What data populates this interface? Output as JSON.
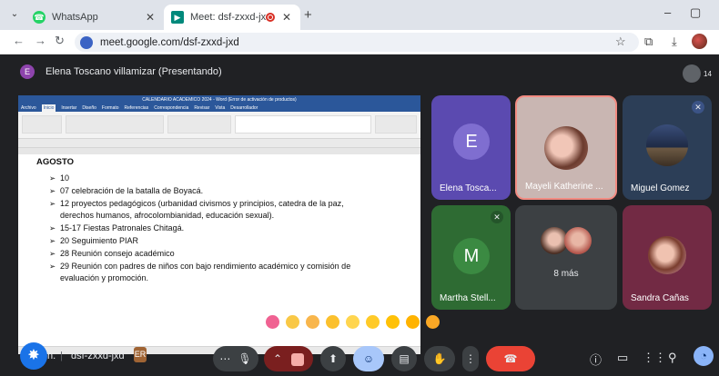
{
  "browser": {
    "tabs": [
      {
        "title": "WhatsApp",
        "icon": "whatsapp-icon"
      },
      {
        "title": "Meet: dsf-zxxd-jxd",
        "icon": "meet-icon",
        "recording": true
      }
    ],
    "url": "meet.google.com/dsf-zxxd-jxd"
  },
  "meet": {
    "presenter_initial": "E",
    "presenter_text": "Elena Toscano villamizar (Presentando)",
    "participant_count": "14",
    "meeting_code": "dsf-zxxd-jxd",
    "host_initial_partial": "n.",
    "code_chip_letter": "ER"
  },
  "document": {
    "window_title": "CALENDARIO ACADEMICO 2024 - Word (Error de activación de productos)",
    "ribbon_tabs": [
      "Archivo",
      "Inicio",
      "Insertar",
      "Diseño",
      "Formato",
      "Referencias",
      "Correspondencia",
      "Revisar",
      "Vista",
      "Desarrollador"
    ],
    "heading": "AGOSTO",
    "items": [
      "10",
      "07 celebración de la batalla de Boyacá.",
      "12 proyectos pedagógicos (urbanidad civismos y principios, catedra de la paz,",
      "derechos humanos, afrocolombianidad, educación sexual).",
      "15-17 Fiestas Patronales Chitagá.",
      "20 Seguimiento PIAR",
      "28 Reunión consejo académico",
      "29 Reunión con padres de niños con bajo rendimiento académico y comisión de",
      "evaluación y promoción."
    ]
  },
  "tiles": [
    {
      "name": "Elena Tosca...",
      "initial": "E",
      "color": "#5b4ab0"
    },
    {
      "name": "Mayeli Katherine ...",
      "color": "#c9b6b2"
    },
    {
      "name": "Miguel Gomez",
      "color": "#2c3e57"
    },
    {
      "name": "Martha Stell...",
      "initial": "M",
      "color": "#2e6b33"
    },
    {
      "name": "8 más",
      "color": "#3c4043"
    },
    {
      "name": "Sandra Cañas",
      "color": "#722a44"
    }
  ],
  "reactions": [
    "sparkling-heart",
    "thumbs-up",
    "party-popper",
    "clapping-hands",
    "joy-face",
    "surprised-face",
    "sad-face",
    "thinking-face",
    "thumbs-down"
  ]
}
